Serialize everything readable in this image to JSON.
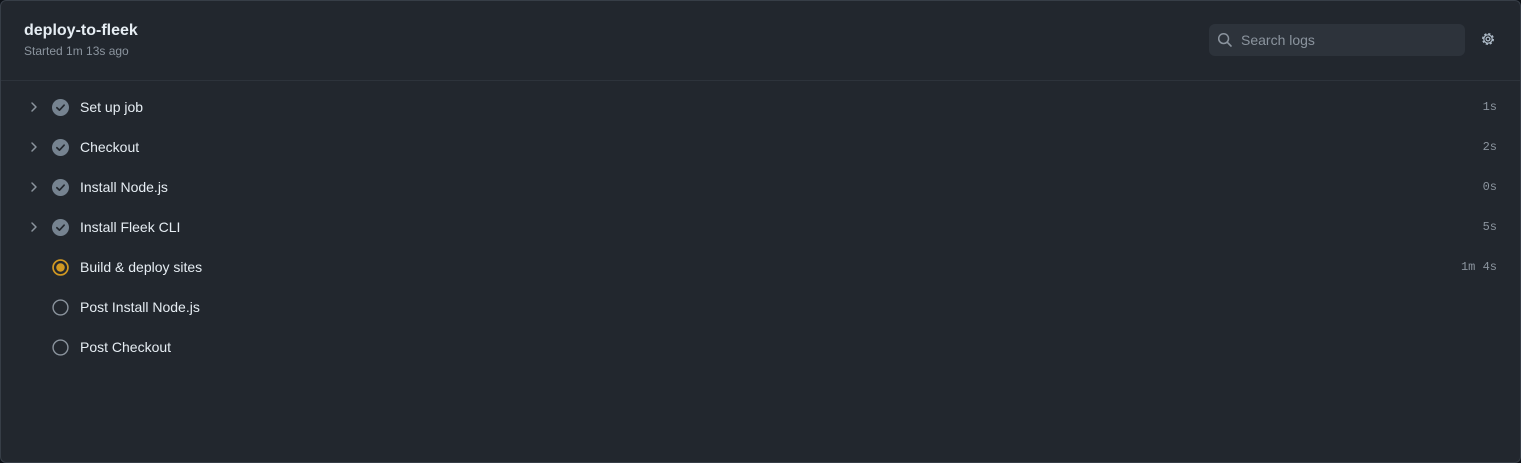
{
  "job": {
    "title": "deploy-to-fleek",
    "subtitle": "Started 1m 13s ago"
  },
  "search": {
    "placeholder": "Search logs",
    "value": ""
  },
  "colors": {
    "success": "#768390",
    "in_progress": "#d29922",
    "queued": "#8b949e"
  },
  "steps": [
    {
      "name": "Set up job",
      "duration": "1s",
      "status": "success",
      "expandable": true
    },
    {
      "name": "Checkout",
      "duration": "2s",
      "status": "success",
      "expandable": true
    },
    {
      "name": "Install Node.js",
      "duration": "0s",
      "status": "success",
      "expandable": true
    },
    {
      "name": "Install Fleek CLI",
      "duration": "5s",
      "status": "success",
      "expandable": true
    },
    {
      "name": "Build & deploy sites",
      "duration": "1m 4s",
      "status": "in_progress",
      "expandable": false
    },
    {
      "name": "Post Install Node.js",
      "duration": "",
      "status": "queued",
      "expandable": false
    },
    {
      "name": "Post Checkout",
      "duration": "",
      "status": "queued",
      "expandable": false
    }
  ]
}
